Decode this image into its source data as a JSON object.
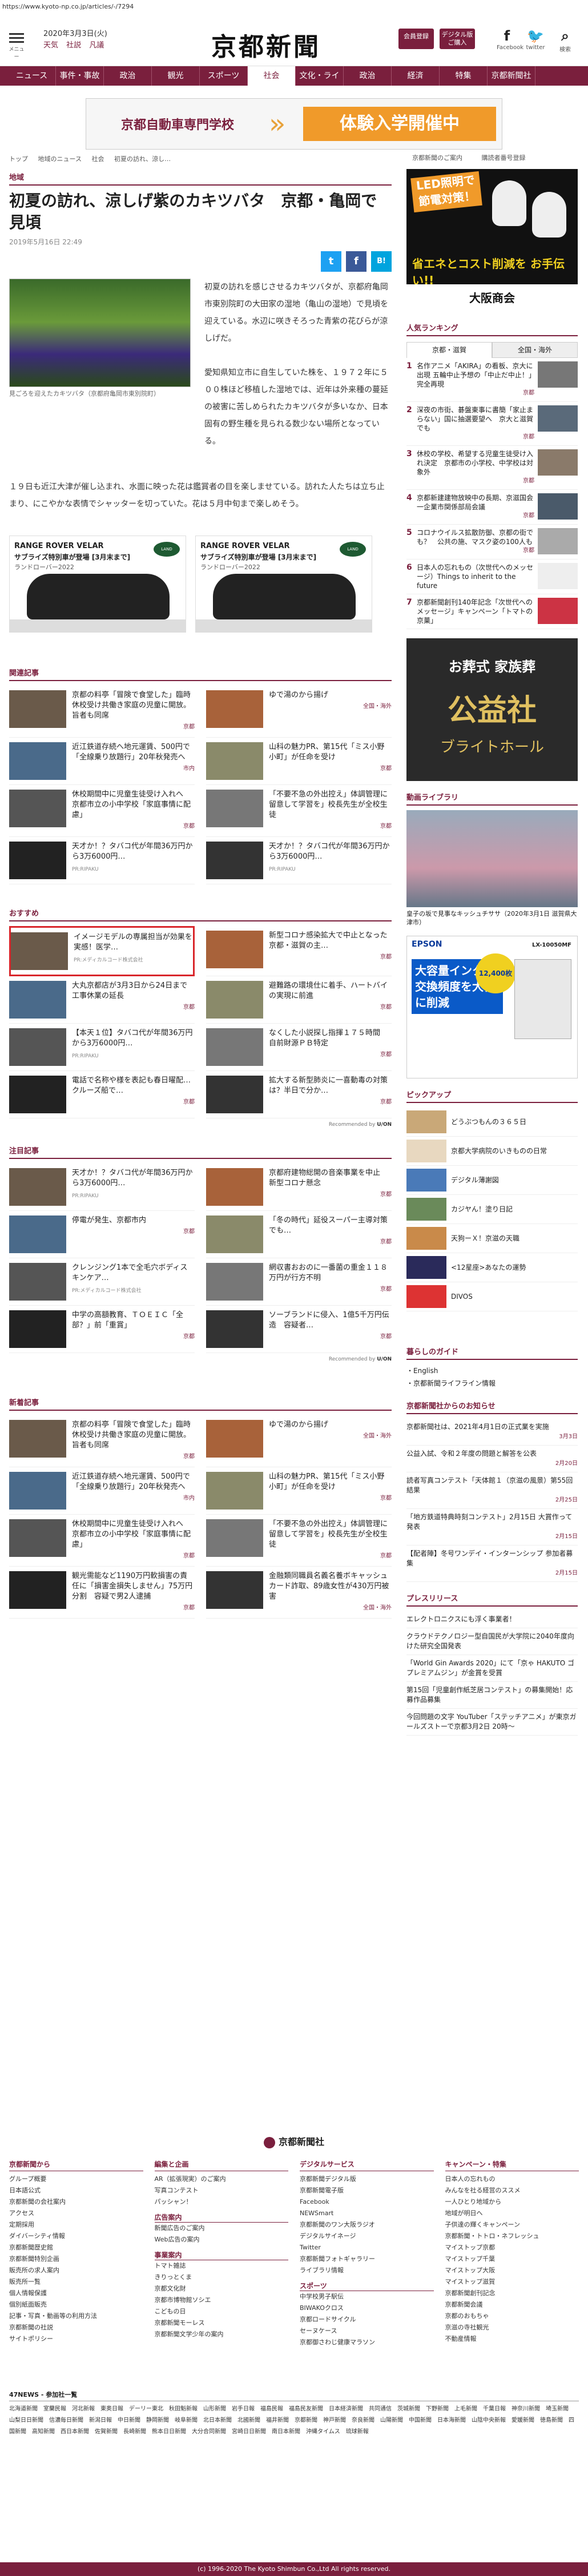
{
  "url": "https://www.kyoto-np.co.jp/articles/-/7294",
  "header": {
    "menu_label": "メニュー",
    "date": "2020年3月3日(火)",
    "weather": [
      "天気",
      "社説",
      "凡議"
    ],
    "logo": "京都新聞",
    "btn_member": "会員登録",
    "btn_digital": "デジタル版ご購入",
    "facebook_label": "Facebook",
    "twitter_label": "twitter",
    "search_label": "検索"
  },
  "gnav": [
    "ニュース",
    "事件・事故",
    "政治",
    "観光",
    "スポーツ",
    "社会",
    "文化・ライフ",
    "政治",
    "経済",
    "特集",
    "京都新聞社"
  ],
  "gnav_active": 5,
  "banner": {
    "left": "京都自動車専門学校",
    "right": "体験入学開催中"
  },
  "breadcrumb": [
    "トップ",
    "地域のニュース",
    "社会",
    "初夏の訪れ、涼し…"
  ],
  "toplinks": [
    "京都新聞のご案内",
    "購読者番号登録"
  ],
  "article": {
    "section": "地域",
    "title": "初夏の訪れ、涼しげ紫のカキツバタ　京都・亀岡で見頃",
    "date": "2019年5月16日 22:49",
    "caption": "見ごろを迎えたカキツバタ（京都府亀岡市東別院町）",
    "p1": "初夏の訪れを感じさせるカキツバタが、京都府亀岡市東別院町の大田家の湿地（亀山の湿地）で見頃を迎えている。水辺に咲きそろった青紫の花びらが涼しげだ。",
    "p2": "愛知県知立市に自生していた株を、１９７２年に５００株ほど移植した湿地では、近年は外来種の蔓延の被害に苦しめられたカキツバタが多いなか、日本固有の野生種を見られる数少ない場所となっている。",
    "p3": "１９日も近江大津が催し込まれ、水面に映った花は鑑賞者の目を楽しませている。訪れた人たちは立ち止まり、にこやかな表情でシャッターを切っていた。花は５月中旬まで楽しめそう。"
  },
  "share": {
    "tw": "t",
    "fb": "f",
    "hb": "B!"
  },
  "car_ad": {
    "t1": "RANGE ROVER VELAR",
    "t2": "サブライズ特別車が登場 [3月末まで]",
    "t3": "ランドローバー2022",
    "badge": "LAND ROVER"
  },
  "sections": {
    "related": "関連記事",
    "recommend": "おすすめ",
    "attention": "注目記事",
    "new": "新着記事"
  },
  "related_items": [
    {
      "t": "京都の料亭「冒険で食堂した」臨時休校受け共働き家庭の児童に開放。旨者も同席",
      "tag": "京都"
    },
    {
      "t": "ゆで湯のから揚げ",
      "tag": "全国・海外"
    },
    {
      "t": "近江鉄道存続へ地元運賃、500円で「全線乗り放題行」20年秋発売へ",
      "tag": "市内"
    },
    {
      "t": "山科の魅力PR、第15代「ミス小野小町」が任命を受け",
      "tag": "京都"
    },
    {
      "t": "休校期間中に児童生徒受け入れへ　京都市立の小中学校「家庭事情に配慮」",
      "tag": "京都"
    },
    {
      "t": "「不要不急の外出控え」体調管理に留意して学習を」校長先生が全校生徒",
      "tag": "京都"
    },
    {
      "t": "天才か！？タバコ代が年間36万円から3万6000円…",
      "tag": "PR:RIPAKU"
    },
    {
      "t": "天才か！？タバコ代が年間36万円から3万6000円…",
      "tag": "PR:RIPAKU"
    }
  ],
  "recommend_items": [
    {
      "t": "イメージモデルの専属担当が効果を実感！医学…",
      "tag": "PR:メディカルコード株式会社"
    },
    {
      "t": "新型コロナ感染拡大で中止となった京都・滋賀の主…",
      "tag": "京都"
    },
    {
      "t": "大丸京都店が3月3日から24日まで工事休業の延長",
      "tag": "京都"
    },
    {
      "t": "避難路の環境仕に着手、ハートバイの実現に前進",
      "tag": "京都"
    },
    {
      "t": "【本天１位】タバコ代が年間36万円から3万6000円…",
      "tag": "PR:RIPAKU"
    },
    {
      "t": "なくした小説探し指揮１７５時間　自前財源ＰＢ特定",
      "tag": "京都"
    },
    {
      "t": "電話で名称や様を表記も春日曜配…クルーズ船で…",
      "tag": "京都"
    },
    {
      "t": "拡大する新型肺炎に一喜動毒の対策は？半日で分か…",
      "tag": "京都"
    }
  ],
  "recommend_credit": "Recommended by",
  "recommend_brand": "U/ON",
  "attention_items": [
    {
      "t": "天才か！？タバコ代が年間36万円から3万6000円…",
      "tag": "PR:RIPAKU"
    },
    {
      "t": "京都府建物総開の音楽事業を中止　新型コロナ懸念",
      "tag": "京都"
    },
    {
      "t": "停電が発生、京都市内",
      "tag": "京都"
    },
    {
      "t": "「冬の時代」延役スーパー主導対策でも…",
      "tag": "京都"
    },
    {
      "t": "クレンジング1本で全毛穴ボディスキンケア…",
      "tag": "PR:メディカルコード株式会社"
    },
    {
      "t": "網収書おおのに一番菌の重金１１８万円が行方不明",
      "tag": "京都"
    },
    {
      "t": "中学の高額教育、ＴＯＥＩＣ「全部？」前「重賞」",
      "tag": "京都"
    },
    {
      "t": "ソーブランドに侵入、1億5千万円伝造　容疑者…",
      "tag": "京都"
    }
  ],
  "new_items": [
    {
      "t": "京都の料亭「冒険で食堂した」臨時休校受け共働き家庭の児童に開放。旨者も同席",
      "tag": "京都"
    },
    {
      "t": "ゆで湯のから揚げ",
      "tag": "全国・海外"
    },
    {
      "t": "近江鉄道存続へ地元運賃、500円で「全線乗り放題行」20年秋発売へ",
      "tag": "市内"
    },
    {
      "t": "山科の魅力PR、第15代「ミス小野小町」が任命を受け",
      "tag": "京都"
    },
    {
      "t": "休校期間中に児童生徒受け入れへ　京都市立の小中学校「家庭事情に配慮」",
      "tag": "京都"
    },
    {
      "t": "「不要不急の外出控え」体調管理に留意して学習を」校長先生が全校生徒",
      "tag": "京都"
    },
    {
      "t": "観光需能など1190万円軟損害の責任に「損害金損失しません」75万円分割　容疑で男2人逮捕",
      "tag": "京都"
    },
    {
      "t": "金融類同職員名義名養ボキャッシュカード詐取、89歳女性が430万円被害",
      "tag": "全国・海外"
    }
  ],
  "side": {
    "ad1": {
      "a": "LED照明で節電対策！",
      "b": "省エネとコスト削減を お手伝い!!",
      "c": "大阪商会"
    },
    "ranking": "人気ランキング",
    "rank_tabs": [
      "京都・滋賀",
      "全国・海外"
    ],
    "ranks": [
      {
        "n": "1",
        "t": "名作アニメ「AKIRA」の看板、京大に出現 五輪中止予想の「中止だ中止！」完全再現",
        "tag": "京都"
      },
      {
        "n": "2",
        "t": "深夜の市街、碁盤東事に書簡「家止まらない」国に抽選要望へ　京大と滋賀でも",
        "tag": "京都"
      },
      {
        "n": "3",
        "t": "休校の学校、希望する児童生徒受け入れ決定　京都市の小学校、中学校は対象外",
        "tag": "京都"
      },
      {
        "n": "4",
        "t": "京都新建建物放映中の長期、京滋国会一企業市関係部局会議",
        "tag": "京都"
      },
      {
        "n": "5",
        "t": "コロナウイルス拡散防御、京都の街でも？　公共の施、マスク姿の100人も",
        "tag": "京都"
      },
      {
        "n": "6",
        "t": "日本人の忘れもの（次世代へのメッセージ）Things to inherit to the future",
        "tag": ""
      },
      {
        "n": "7",
        "t": "京都新聞創刊140年記念「次世代へのメッセージ」キャンペーン「トマトの京菓」",
        "tag": ""
      }
    ],
    "ad2": {
      "a": "お葬式 家族葬",
      "b": "公益社",
      "c": "ブライトホール"
    },
    "video": "動画ライブラリ",
    "video_cap": "皇子の坂で見事なキッシュチササ（2020年3月1日 滋賀県大津市）",
    "epson": {
      "logo": "EPSON",
      "big": "大容量インクで交換頻度を大幅に削減",
      "circ": "12,400枚",
      "model": "LX-10050MF"
    },
    "pickup": "ピックアップ",
    "picks": [
      "どうぶつもんの３６５日",
      "京都大学病院のいきものの日常",
      "デジタル薄謝図",
      "カジヤん！塗り日記",
      "天狗ーＸ！京滋の天職",
      "<12星座>あなたの運勢",
      "DIVOS"
    ],
    "guide": "暮らしのガイド",
    "guide_items": [
      "・English",
      "・京都新聞ライフライン情報"
    ],
    "notice": "京都新聞社からのお知らせ",
    "notices": [
      {
        "t": "京都新聞社は、2021年4月1日の正式業を実施",
        "tag": "3月3日"
      },
      {
        "t": "公益入試、令和２年度の問題と解答を公表",
        "tag": "2月20日"
      },
      {
        "t": "読者写真コンテスト「天体館１（京滋の風景）第55回結果",
        "tag": "2月25日"
      },
      {
        "t": "「地方鉄道特典時刻コンテスト」2月15日 大賞作って発表",
        "tag": "2月15日"
      },
      {
        "t": "【配者陣】冬号ワンデイ・インターンシップ 参加者募集",
        "tag": "2月15日"
      }
    ],
    "press": "プレスリリース",
    "presses": [
      "エレクトロニクスにも浮く事業者！",
      "クラウドテクノロジー型自国民が大学院に2040年度向けた研究全国発表",
      "「World Gin Awards 2020」にて「京ゃ HAKUTO ゴプレミアムジン」が金賞を受賞",
      "第15回「児童創作紙芝居コンテスト」の募集開始！応募作品募集",
      "今回問題の文字 YouTuber「ステッチアニメ」が東京ガールズストーで京都3月2日 20時～"
    ]
  },
  "footer": {
    "logo": "京都新聞社",
    "cols": [
      {
        "h": "京都新聞から",
        "l": [
          "グループ概要",
          "日本語公式",
          "京都新聞の会社案内",
          "アクセス",
          "定期採用",
          "ダイバーシティ情報",
          "京都新聞歴史館",
          "京都新聞特別企画",
          "販売所の求人案内",
          "販売所一覧",
          "個人情報保護",
          "個別紙面販売",
          "記事・写真・動画等の利用方法",
          "京都新聞の社説",
          "サイトポリシー"
        ]
      },
      {
        "h": "編集と企画",
        "l": [
          "AR（拡張現実）のご案内",
          "写真コンテスト",
          "パッシャン！"
        ],
        "sub": "広告案内",
        "sl": [
          "新聞広告のご案内",
          "Web広告の案内"
        ],
        "sub2": "事業案内",
        "sl2": [
          "トマト雑誌",
          "きりっとくま",
          "京都文化財",
          "京都市博物館ソシエ",
          "こどもの日",
          "京都新聞モーレス",
          "京都新聞文学少年の案内"
        ]
      },
      {
        "h": "デジタルサービス",
        "l": [
          "京都新聞デジタル版",
          "京都新聞電子版",
          "Facebook",
          "NEWSmart",
          "京都新聞のワン大阪ラジオ",
          "デジタルサイネージ",
          "Twitter",
          "京都新聞フォトギャラリー",
          "ライブラリ情報"
        ],
        "sub": "スポーツ",
        "sl": [
          "中学校男子駅伝",
          "BIWAKOクロス",
          "京都ロードサイクル",
          "セーヌケース",
          "京都御さわじ健康マラソン"
        ]
      },
      {
        "h": "キャンペーン・特集",
        "l": [
          "日本人の忘れもの",
          "みんなを社る経営のススメ",
          "一人ひとり地域から",
          "地域が明日へ",
          "子供達の輝くキャンペーン",
          "京都新聞・トトロ・ネフレッシュ",
          "マイストップ京都",
          "マイストップ千葉",
          "マイストップ大阪",
          "マイストップ滋賀",
          "京都新聞創刊記念",
          "京都新聞会議",
          "京都のおもちゃ",
          "京滋の寺社観光",
          "不動産情報"
        ]
      }
    ],
    "network_h": "47NEWS - 参加社一覧",
    "network": [
      "北海道新聞",
      "室蘭民報",
      "河北新報",
      "東奥日報",
      "デーリー東北",
      "秋田魁新報",
      "山形新聞",
      "岩手日報",
      "福島民報",
      "福島民友新聞",
      "日本経済新聞",
      "共同通信",
      "茨城新聞",
      "下野新聞",
      "上毛新聞",
      "千葉日報",
      "神奈川新聞",
      "埼玉新聞",
      "山梨日日新聞",
      "信濃毎日新聞",
      "新潟日報",
      "中日新聞",
      "静岡新聞",
      "岐阜新聞",
      "北日本新聞",
      "北國新聞",
      "福井新聞",
      "京都新聞",
      "神戸新聞",
      "奈良新聞",
      "山陽新聞",
      "中国新聞",
      "日本海新聞",
      "山陰中央新報",
      "愛媛新聞",
      "徳島新聞",
      "四国新聞",
      "高知新聞",
      "西日本新聞",
      "佐賀新聞",
      "長崎新聞",
      "熊本日日新聞",
      "大分合同新聞",
      "宮崎日日新聞",
      "南日本新聞",
      "沖縄タイムス",
      "琉球新報"
    ],
    "copyright": "(c) 1996-2020 The Kyoto Shimbun Co.,Ltd All rights reserved."
  }
}
